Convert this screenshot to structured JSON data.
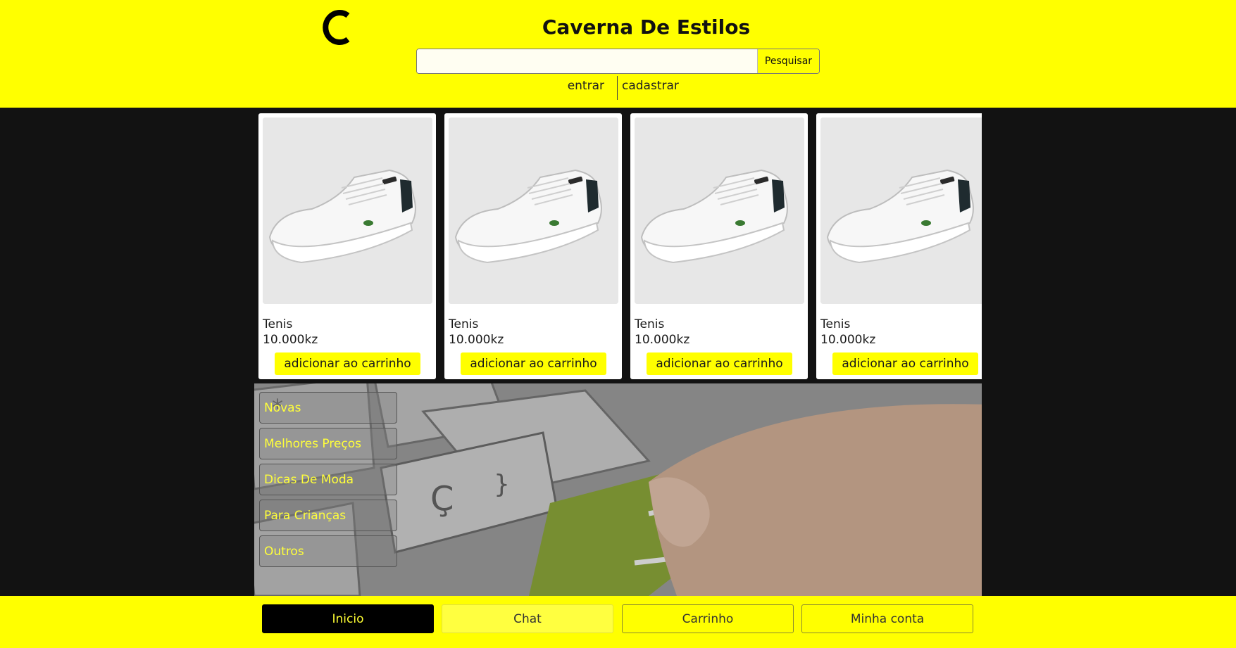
{
  "header": {
    "title": "Caverna De Estilos",
    "search": {
      "placeholder": "",
      "value": "",
      "button_label": "Pesquisar"
    },
    "auth": {
      "login_label": "entrar",
      "register_label": "cadastrar"
    }
  },
  "products": [
    {
      "name": "Tenis",
      "price": "10.000kz",
      "button_label": "adicionar ao carrinho"
    },
    {
      "name": "Tenis",
      "price": "10.000kz",
      "button_label": "adicionar ao carrinho"
    },
    {
      "name": "Tenis",
      "price": "10.000kz",
      "button_label": "adicionar ao carrinho"
    },
    {
      "name": "Tenis",
      "price": "10.000kz",
      "button_label": "adicionar ao carrinho"
    }
  ],
  "categories": [
    "Novas",
    "Melhores Preços",
    "Dicas De Moda",
    "Para Crianças",
    "Outros"
  ],
  "bottom_nav": {
    "items": [
      "Inicio",
      "Chat",
      "Carrinho",
      "Minha conta"
    ],
    "active": "Inicio"
  },
  "colors": {
    "brand_yellow": "#ffff00",
    "background": "#121212"
  }
}
